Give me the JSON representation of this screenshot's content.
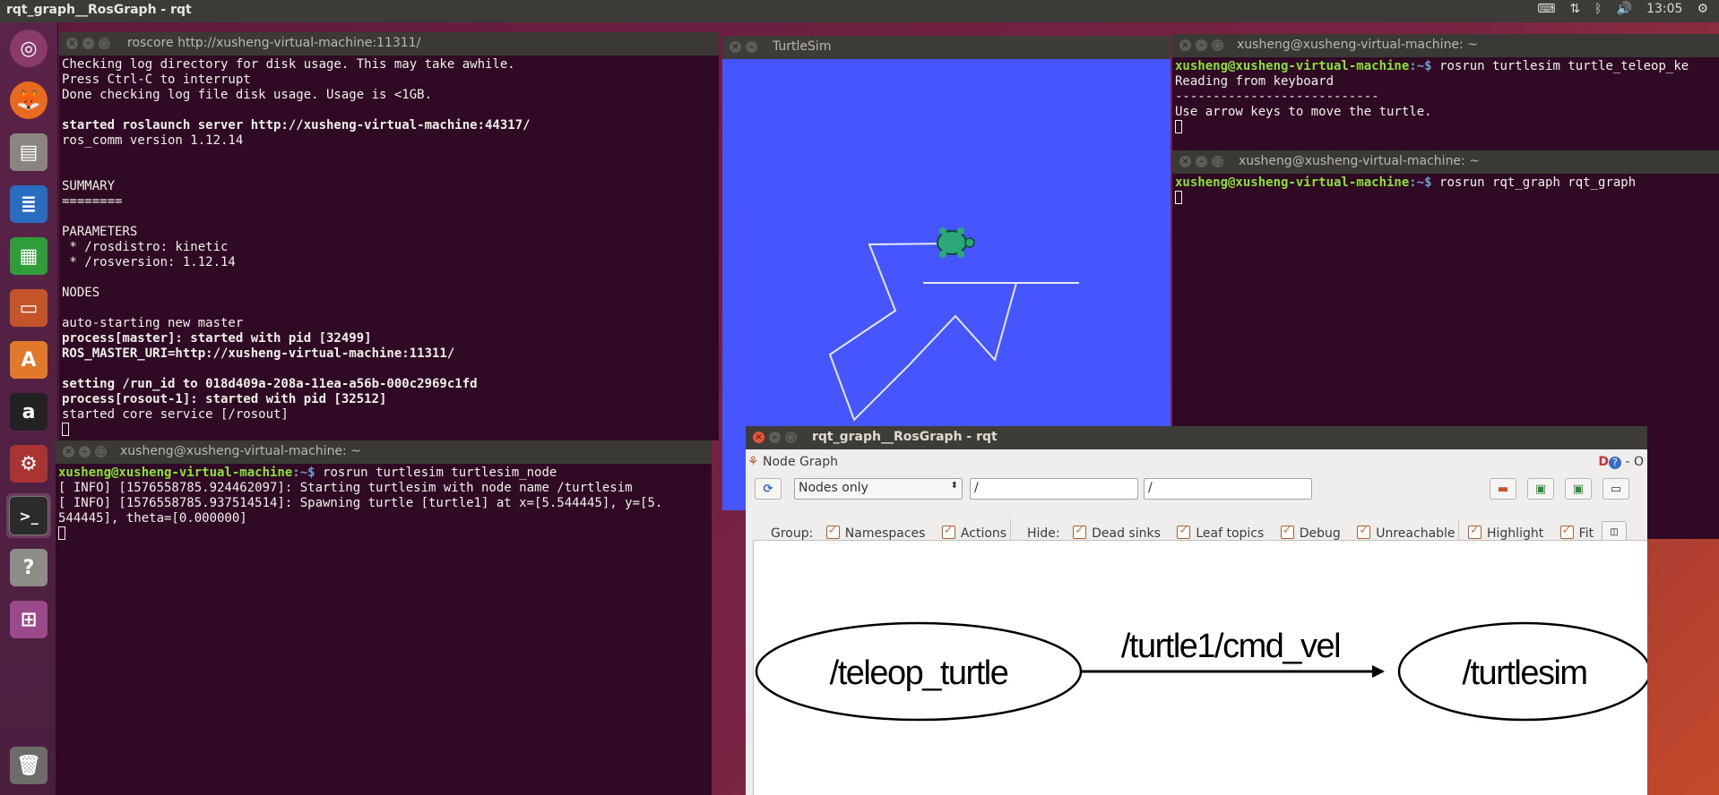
{
  "top_panel": {
    "title": "rqt_graph__RosGraph - rqt",
    "time": "13:05"
  },
  "launcher": {
    "items": [
      "ubuntu-dash-icon",
      "firefox-icon",
      "files-icon",
      "writer-icon",
      "calc-icon",
      "impress-icon",
      "software-center-icon",
      "amazon-icon",
      "settings-icon",
      "terminal-icon",
      "help-icon",
      "workspace-switcher-icon",
      "trash-icon"
    ]
  },
  "roscore_window": {
    "title": "roscore http://xusheng-virtual-machine:11311/",
    "lines": [
      "Checking log directory for disk usage. This may take awhile.",
      "Press Ctrl-C to interrupt",
      "Done checking log file disk usage. Usage is <1GB.",
      "",
      "started roslaunch server http://xusheng-virtual-machine:44317/",
      "ros_comm version 1.12.14",
      "",
      "",
      "SUMMARY",
      "========",
      "",
      "PARAMETERS",
      " * /rosdistro: kinetic",
      " * /rosversion: 1.12.14",
      "",
      "NODES",
      "",
      "auto-starting new master",
      "process[master]: started with pid [32499]",
      "ROS_MASTER_URI=http://xusheng-virtual-machine:11311/",
      "",
      "setting /run_id to 018d409a-208a-11ea-a56b-000c2969c1fd",
      "process[rosout-1]: started with pid [32512]",
      "started core service [/rosout]"
    ]
  },
  "turtlesim_node_window": {
    "title": "xusheng@xusheng-virtual-machine: ~",
    "prompt_user": "xusheng@xusheng-virtual-machine",
    "prompt_path": ":~$",
    "command": " rosrun turtlesim turtlesim_node",
    "lines": [
      "[ INFO] [1576558785.924462097]: Starting turtlesim with node name /turtlesim",
      "[ INFO] [1576558785.937514514]: Spawning turtle [turtle1] at x=[5.544445], y=[5.",
      "544445], theta=[0.000000]"
    ]
  },
  "turtlesim_window": {
    "title": "TurtleSim"
  },
  "teleop_window": {
    "title": "xusheng@xusheng-virtual-machine: ~",
    "prompt_user": "xusheng@xusheng-virtual-machine",
    "prompt_path": ":~$",
    "command": " rosrun turtlesim turtle_teleop_ke",
    "lines": [
      "Reading from keyboard",
      "---------------------------",
      "Use arrow keys to move the turtle."
    ]
  },
  "rqt_graph_terminal": {
    "title": "xusheng@xusheng-virtual-machine: ~",
    "prompt_user": "xusheng@xusheng-virtual-machine",
    "prompt_path": ":~$",
    "command": " rosrun rqt_graph rqt_graph"
  },
  "rqt_window": {
    "title": "rqt_graph__RosGraph - rqt",
    "plugin_title": "Node Graph",
    "plugin_controls": "D",
    "plugin_close": "- O",
    "mode_select": "Nodes only",
    "filter_ns": "/",
    "filter_topic": "/",
    "group_label": "Group:",
    "group_options": [
      "Namespaces",
      "Actions"
    ],
    "hide_label": "Hide:",
    "hide_options": [
      "Dead sinks",
      "Leaf topics",
      "Debug",
      "Unreachable"
    ],
    "view_options": [
      "Highlight",
      "Fit"
    ],
    "graph": {
      "source_node": "/teleop_turtle",
      "topic": "/turtle1/cmd_vel",
      "target_node": "/turtlesim"
    }
  },
  "colors": {
    "terminal_bg": "#300a24",
    "prompt_green": "#8ae234",
    "prompt_blue": "#729fcf",
    "turtlesim_bg": "#4556ff",
    "checkbox_orange": "#e0683a"
  }
}
